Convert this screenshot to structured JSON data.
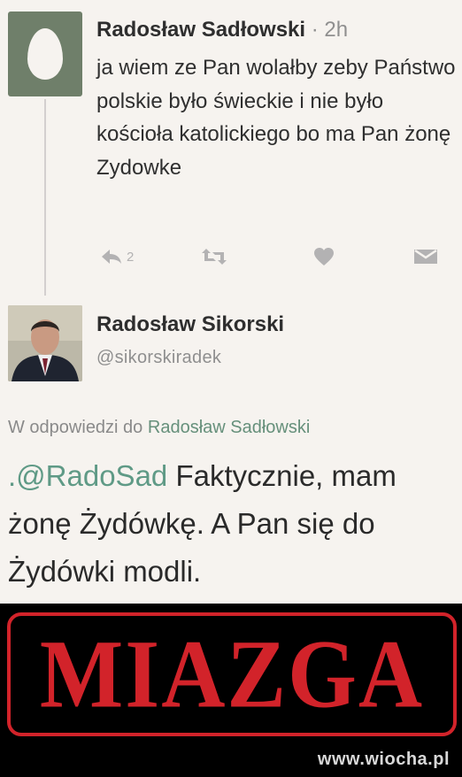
{
  "tweet1": {
    "author_name": "Radosław Sadłowski",
    "separator": "·",
    "time": "2h",
    "text": "ja wiem ze Pan wolałby zeby Państwo polskie było świeckie i nie było kościoła katolickiego bo ma Pan żonę Zydowke",
    "reply_count": "2",
    "icons": [
      "reply-icon",
      "retweet-icon",
      "like-icon",
      "message-icon"
    ]
  },
  "tweet2": {
    "author_name": "Radosław Sikorski",
    "handle": "@sikorskiradek",
    "reply_prefix": "W odpowiedzi do",
    "reply_target": "Radosław Sadłowski",
    "mention": ".@RadoSad",
    "text": " Faktycznie, mam żonę Żydówkę.  A Pan się do Żydówki modli."
  },
  "banner": {
    "word": "MIAZGA",
    "watermark": "www.wiocha.pl"
  },
  "colors": {
    "banner_red": "#d2232a",
    "mention_green": "#5f9a86",
    "background": "#f6f3ef"
  }
}
